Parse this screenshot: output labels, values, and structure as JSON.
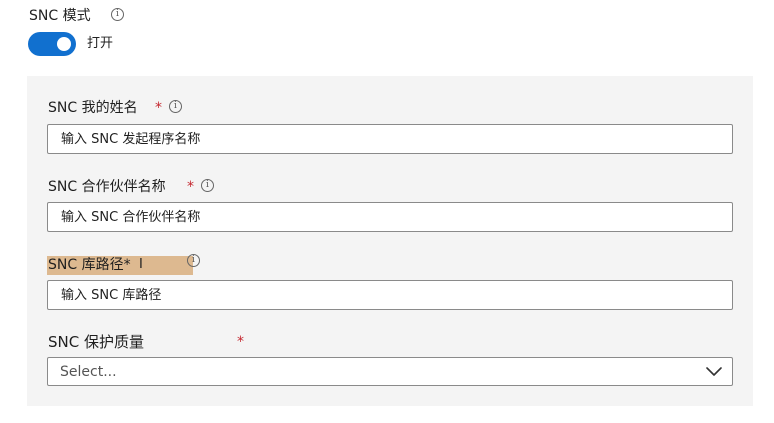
{
  "mode": {
    "label": "SNC 模式",
    "toggle_label": "打开",
    "toggle_on": true
  },
  "fields": {
    "my_name": {
      "label": "SNC 我的姓名",
      "required_mark": "*",
      "placeholder": "输入 SNC 发起程序名称"
    },
    "partner_name": {
      "label": "SNC 合作伙伴名称",
      "required_mark": "*",
      "placeholder": "输入 SNC 合作伙伴名称"
    },
    "library_path": {
      "label": "SNC 库路径*",
      "cursor": "I",
      "placeholder": "输入 SNC 库路径"
    },
    "qop": {
      "label": "SNC 保护质量",
      "required_mark": "*",
      "selected": "Select..."
    }
  },
  "info_glyph": "i",
  "colors": {
    "toggle_on": "#1170cf",
    "required": "#c4262e",
    "highlight": "#ddb990",
    "panel": "#f4f4f4"
  },
  "icons": {
    "info": "info-circle-icon",
    "dropdown": "chevron-down-icon"
  }
}
